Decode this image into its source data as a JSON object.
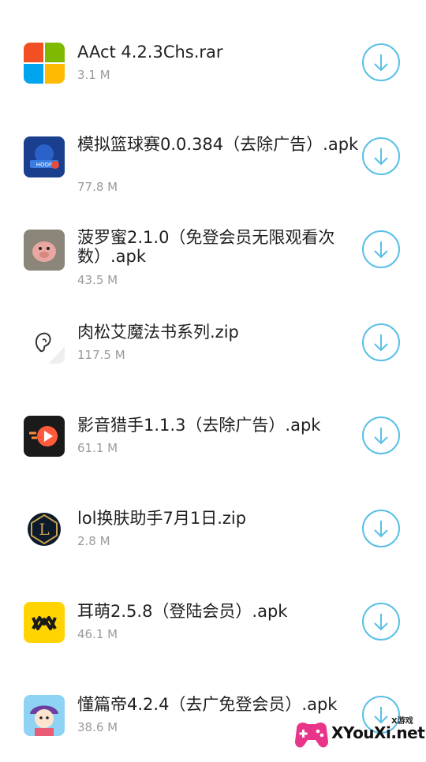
{
  "files": [
    {
      "name": "AAct 4.2.3Chs.rar",
      "size": "3.1 M",
      "icon": "windows-logo-icon"
    },
    {
      "name": "模拟篮球赛0.0.384（去除广告）.apk",
      "size": "77.8 M",
      "icon": "basketball-game-icon"
    },
    {
      "name": "菠罗蜜2.1.0（免登会员无限观看次数）.apk",
      "size": "43.5 M",
      "icon": "pig-toy-icon"
    },
    {
      "name": "肉松艾魔法书系列.zip",
      "size": "117.5 M",
      "icon": "ear-icon"
    },
    {
      "name": "影音猎手1.1.3（去除广告）.apk",
      "size": "61.1 M",
      "icon": "play-button-icon"
    },
    {
      "name": "lol换肤助手7月1日.zip",
      "size": "2.8 M",
      "icon": "league-logo-icon"
    },
    {
      "name": "耳萌2.5.8（登陆会员）.apk",
      "size": "46.1 M",
      "icon": "ermeng-logo-icon"
    },
    {
      "name": "懂篇帝4.2.4（去广免登会员）.apk",
      "size": "38.6 M",
      "icon": "anime-character-icon"
    }
  ],
  "watermark": {
    "small": "X游戏",
    "text": "XYouXi.net"
  },
  "colors": {
    "accent": "#59c0e6",
    "name_text": "#1f1f1f",
    "size_text": "#9a9a9a"
  }
}
